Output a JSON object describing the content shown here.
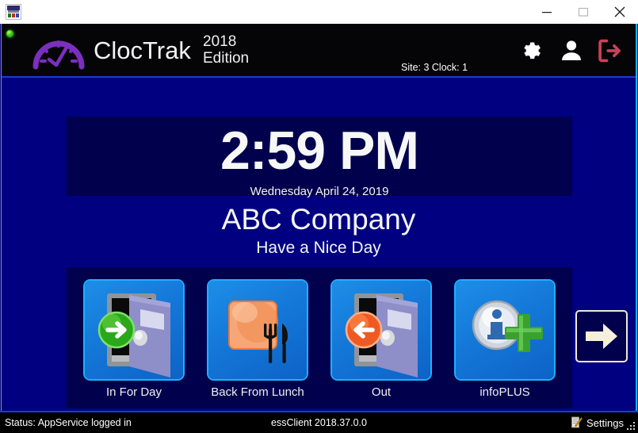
{
  "window": {
    "app_icon_name": "app-icon",
    "controls": {
      "minimize_label": "Minimize",
      "maximize_label": "Maximize",
      "close_label": "Close"
    }
  },
  "header": {
    "status_led_color": "#37cf12",
    "logo_icon": "gauge-icon",
    "logo_color": "#7B2FBE",
    "brand": "ClocTrak",
    "edition_year": "2018",
    "edition_word": "Edition",
    "site_clock": "Site: 3 Clock: 1",
    "icons": [
      {
        "name": "gear-icon",
        "color": "#ffffff"
      },
      {
        "name": "user-icon",
        "color": "#ffffff"
      },
      {
        "name": "logout-icon",
        "color": "#c94257"
      }
    ]
  },
  "clock": {
    "time": "2:59 PM",
    "date": "Wednesday  April 24, 2019",
    "panel_color": "#00004d"
  },
  "company": {
    "name": "ABC Company",
    "greeting": "Have a Nice Day"
  },
  "punch_buttons": [
    {
      "label": "In For Day",
      "icon": "door-in-icon",
      "accent": "#3caf20"
    },
    {
      "label": "Back From Lunch",
      "icon": "meal-icon",
      "accent": "#f2854a"
    },
    {
      "label": "Out",
      "icon": "door-out-icon",
      "accent": "#f2542a"
    },
    {
      "label": "infoPLUS",
      "icon": "info-plus-icon",
      "accent": "#2f9e2f"
    }
  ],
  "next_button": {
    "name": "next-page-button",
    "icon": "arrow-right-icon",
    "color": "#f5efdc"
  },
  "statusbar": {
    "status_text": "Status: AppService logged in",
    "version_text": "essClient 2018.37.0.0",
    "settings_label": "Settings",
    "settings_icon": "notepad-pencil-icon"
  },
  "theme": {
    "body_blue": "#000080",
    "panel_blue": "#00004d",
    "header_black": "#050508",
    "divider_blue": "#1b3bd6",
    "tile_blue": "#1478d8",
    "tile_glow": "#1fb0ff"
  }
}
